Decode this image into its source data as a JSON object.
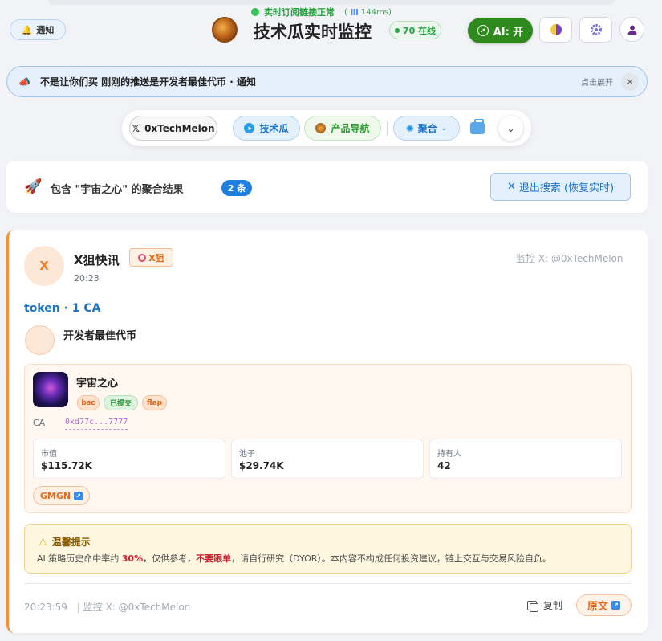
{
  "header": {
    "status_text": "实时订阅链接正常",
    "latency": "144ms",
    "notice_label": "通知",
    "title": "技术瓜实时监控",
    "online": "70 在线",
    "ai_label": "AI: 开"
  },
  "banner": {
    "text": "不是让你们买 刚刚的推送是开发者最佳代币 · 通知",
    "expand": "点击展开",
    "close": "×"
  },
  "tabs": {
    "x_label": "0xTechMelon",
    "tg_label": "技术瓜",
    "nav_label": "产品导航",
    "agg_label": "聚合"
  },
  "search": {
    "label": "包含 \"宇宙之心\" 的聚合结果",
    "count": "2 条",
    "exit_label": "退出搜索 (恢复实时)"
  },
  "post": {
    "source_initial": "X",
    "source_name": "X狙快讯",
    "source_tag": "X狙",
    "time": "20:23",
    "monitor": "监控 X: @0xTechMelon",
    "token_line": "token · 1 CA",
    "dev_name": "开发者最佳代币",
    "token": {
      "name": "宇宙之心",
      "badges": [
        "bsc",
        "已提交",
        "flap"
      ],
      "ca_label": "CA",
      "ca_value": "0xd77c...7777",
      "stats": [
        {
          "key": "市值",
          "value": "$115.72K"
        },
        {
          "key": "池子",
          "value": "$29.74K"
        },
        {
          "key": "持有人",
          "value": "42"
        }
      ],
      "gmgn": "GMGN"
    },
    "warning": {
      "title": "温馨提示",
      "p1": "AI 策略历史命中率约 ",
      "rate": "30%",
      "p2": "，仅供参考，",
      "nofollow": "不要跟单",
      "p3": "，请自行研究（DYOR）。本内容不构成任何投资建议，链上交互与交易风险自负。"
    },
    "footer_time": "20:23:59",
    "footer_monitor": "| 监控 X: @0xTechMelon",
    "copy_label": "复制",
    "original_label": "原文"
  }
}
